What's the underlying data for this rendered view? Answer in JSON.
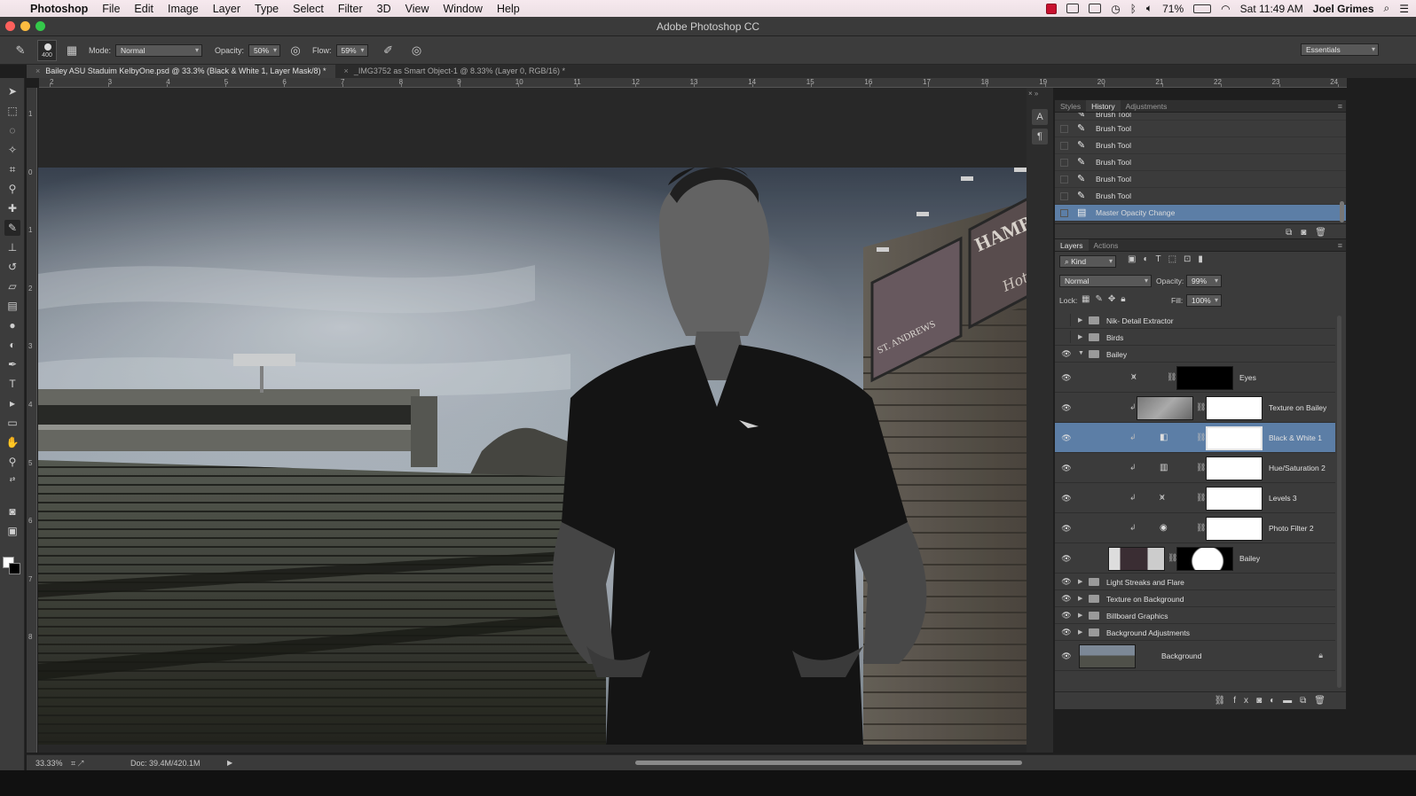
{
  "menubar": {
    "app": "Photoshop",
    "menus": [
      "File",
      "Edit",
      "Image",
      "Layer",
      "Type",
      "Select",
      "Filter",
      "3D",
      "View",
      "Window",
      "Help"
    ],
    "battery": "71%",
    "clock": "Sat 11:49 AM",
    "user": "Joel Grimes"
  },
  "window": {
    "title": "Adobe Photoshop CC"
  },
  "options": {
    "brush_size": "400",
    "mode_label": "Mode:",
    "mode_value": "Normal",
    "opacity_label": "Opacity:",
    "opacity_value": "50%",
    "flow_label": "Flow:",
    "flow_value": "59%",
    "workspace": "Essentials"
  },
  "tabs": [
    {
      "label": "Bailey ASU Staduim KelbyOne.psd @ 33.3% (Black & White 1, Layer Mask/8) *",
      "active": true
    },
    {
      "label": "_IMG3752 as Smart Object-1 @ 8.33% (Layer 0, RGB/16) *",
      "active": false
    }
  ],
  "ruler": {
    "h": [
      "2",
      "3",
      "4",
      "5",
      "6",
      "7",
      "8",
      "9",
      "10",
      "11",
      "12",
      "13",
      "14",
      "15",
      "16",
      "17",
      "18",
      "19",
      "20",
      "21",
      "22",
      "23",
      "24"
    ],
    "v": [
      "1",
      "0",
      "1",
      "2",
      "3",
      "4",
      "5",
      "6",
      "7",
      "8"
    ]
  },
  "history": {
    "tabs": [
      "Styles",
      "History",
      "Adjustments"
    ],
    "active_tab": "History",
    "partial_item": "Brush Tool",
    "items": [
      "Brush Tool",
      "Brush Tool",
      "Brush Tool",
      "Brush Tool",
      "Brush Tool",
      "Master Opacity Change"
    ],
    "selected": "Master Opacity Change"
  },
  "layers": {
    "tabs": [
      "Layers",
      "Actions"
    ],
    "active_tab": "Layers",
    "filter_value": "Kind",
    "blend_mode": "Normal",
    "opacity_label": "Opacity:",
    "opacity_value": "99%",
    "lock_label": "Lock:",
    "fill_label": "Fill:",
    "fill_value": "100%",
    "items": [
      {
        "name": "Nik- Detail Extractor",
        "kind": "group",
        "visible": false,
        "expanded": false
      },
      {
        "name": "Birds",
        "kind": "group",
        "visible": false,
        "expanded": false
      },
      {
        "name": "Bailey",
        "kind": "group",
        "visible": true,
        "expanded": true
      },
      {
        "name": "Eyes",
        "kind": "adjustment-levels",
        "visible": true
      },
      {
        "name": "Texture on Bailey",
        "kind": "texture",
        "visible": true
      },
      {
        "name": "Black & White 1",
        "kind": "adjustment-bw",
        "visible": true,
        "selected": true
      },
      {
        "name": "Hue/Saturation 2",
        "kind": "adjustment-hue",
        "visible": true
      },
      {
        "name": "Levels 3",
        "kind": "adjustment-levels",
        "visible": true
      },
      {
        "name": "Photo Filter 2",
        "kind": "adjustment-photo",
        "visible": true
      },
      {
        "name": "Bailey",
        "kind": "pixel-masked",
        "visible": true
      },
      {
        "name": "Light Streaks and Flare",
        "kind": "group",
        "visible": true,
        "expanded": false
      },
      {
        "name": "Texture on Background",
        "kind": "group",
        "visible": true,
        "expanded": false
      },
      {
        "name": "Billboard Graphics",
        "kind": "group",
        "visible": true,
        "expanded": false
      },
      {
        "name": "Background Adjustments",
        "kind": "group",
        "visible": true,
        "expanded": false
      },
      {
        "name": "Background",
        "kind": "background",
        "visible": true,
        "locked": true
      }
    ]
  },
  "status": {
    "zoom": "33.33%",
    "doc": "Doc: 39.4M/420.1M"
  },
  "artwork": {
    "billboard_top": "HAMB",
    "billboard_script": "Hot &",
    "billboard_lower": "ST. ANDREWS"
  }
}
